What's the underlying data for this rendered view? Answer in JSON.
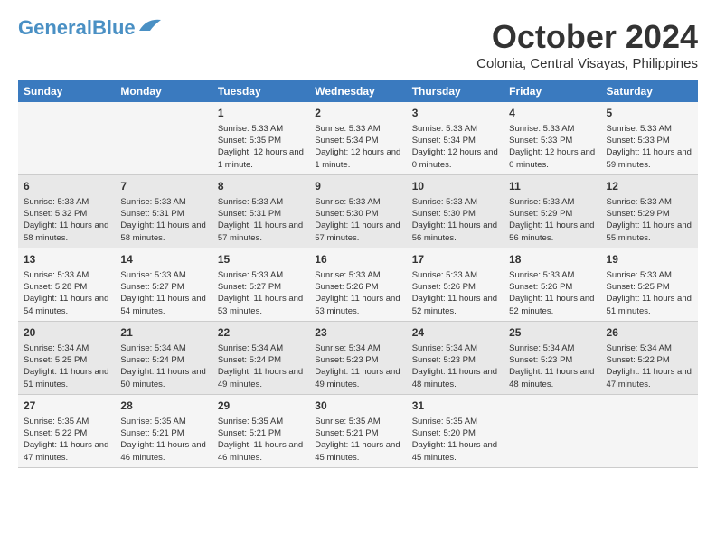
{
  "logo": {
    "part1": "General",
    "part2": "Blue"
  },
  "title": "October 2024",
  "location": "Colonia, Central Visayas, Philippines",
  "weekdays": [
    "Sunday",
    "Monday",
    "Tuesday",
    "Wednesday",
    "Thursday",
    "Friday",
    "Saturday"
  ],
  "weeks": [
    [
      {
        "day": "",
        "info": ""
      },
      {
        "day": "",
        "info": ""
      },
      {
        "day": "1",
        "info": "Sunrise: 5:33 AM\nSunset: 5:35 PM\nDaylight: 12 hours and 1 minute."
      },
      {
        "day": "2",
        "info": "Sunrise: 5:33 AM\nSunset: 5:34 PM\nDaylight: 12 hours and 1 minute."
      },
      {
        "day": "3",
        "info": "Sunrise: 5:33 AM\nSunset: 5:34 PM\nDaylight: 12 hours and 0 minutes."
      },
      {
        "day": "4",
        "info": "Sunrise: 5:33 AM\nSunset: 5:33 PM\nDaylight: 12 hours and 0 minutes."
      },
      {
        "day": "5",
        "info": "Sunrise: 5:33 AM\nSunset: 5:33 PM\nDaylight: 11 hours and 59 minutes."
      }
    ],
    [
      {
        "day": "6",
        "info": "Sunrise: 5:33 AM\nSunset: 5:32 PM\nDaylight: 11 hours and 58 minutes."
      },
      {
        "day": "7",
        "info": "Sunrise: 5:33 AM\nSunset: 5:31 PM\nDaylight: 11 hours and 58 minutes."
      },
      {
        "day": "8",
        "info": "Sunrise: 5:33 AM\nSunset: 5:31 PM\nDaylight: 11 hours and 57 minutes."
      },
      {
        "day": "9",
        "info": "Sunrise: 5:33 AM\nSunset: 5:30 PM\nDaylight: 11 hours and 57 minutes."
      },
      {
        "day": "10",
        "info": "Sunrise: 5:33 AM\nSunset: 5:30 PM\nDaylight: 11 hours and 56 minutes."
      },
      {
        "day": "11",
        "info": "Sunrise: 5:33 AM\nSunset: 5:29 PM\nDaylight: 11 hours and 56 minutes."
      },
      {
        "day": "12",
        "info": "Sunrise: 5:33 AM\nSunset: 5:29 PM\nDaylight: 11 hours and 55 minutes."
      }
    ],
    [
      {
        "day": "13",
        "info": "Sunrise: 5:33 AM\nSunset: 5:28 PM\nDaylight: 11 hours and 54 minutes."
      },
      {
        "day": "14",
        "info": "Sunrise: 5:33 AM\nSunset: 5:27 PM\nDaylight: 11 hours and 54 minutes."
      },
      {
        "day": "15",
        "info": "Sunrise: 5:33 AM\nSunset: 5:27 PM\nDaylight: 11 hours and 53 minutes."
      },
      {
        "day": "16",
        "info": "Sunrise: 5:33 AM\nSunset: 5:26 PM\nDaylight: 11 hours and 53 minutes."
      },
      {
        "day": "17",
        "info": "Sunrise: 5:33 AM\nSunset: 5:26 PM\nDaylight: 11 hours and 52 minutes."
      },
      {
        "day": "18",
        "info": "Sunrise: 5:33 AM\nSunset: 5:26 PM\nDaylight: 11 hours and 52 minutes."
      },
      {
        "day": "19",
        "info": "Sunrise: 5:33 AM\nSunset: 5:25 PM\nDaylight: 11 hours and 51 minutes."
      }
    ],
    [
      {
        "day": "20",
        "info": "Sunrise: 5:34 AM\nSunset: 5:25 PM\nDaylight: 11 hours and 51 minutes."
      },
      {
        "day": "21",
        "info": "Sunrise: 5:34 AM\nSunset: 5:24 PM\nDaylight: 11 hours and 50 minutes."
      },
      {
        "day": "22",
        "info": "Sunrise: 5:34 AM\nSunset: 5:24 PM\nDaylight: 11 hours and 49 minutes."
      },
      {
        "day": "23",
        "info": "Sunrise: 5:34 AM\nSunset: 5:23 PM\nDaylight: 11 hours and 49 minutes."
      },
      {
        "day": "24",
        "info": "Sunrise: 5:34 AM\nSunset: 5:23 PM\nDaylight: 11 hours and 48 minutes."
      },
      {
        "day": "25",
        "info": "Sunrise: 5:34 AM\nSunset: 5:23 PM\nDaylight: 11 hours and 48 minutes."
      },
      {
        "day": "26",
        "info": "Sunrise: 5:34 AM\nSunset: 5:22 PM\nDaylight: 11 hours and 47 minutes."
      }
    ],
    [
      {
        "day": "27",
        "info": "Sunrise: 5:35 AM\nSunset: 5:22 PM\nDaylight: 11 hours and 47 minutes."
      },
      {
        "day": "28",
        "info": "Sunrise: 5:35 AM\nSunset: 5:21 PM\nDaylight: 11 hours and 46 minutes."
      },
      {
        "day": "29",
        "info": "Sunrise: 5:35 AM\nSunset: 5:21 PM\nDaylight: 11 hours and 46 minutes."
      },
      {
        "day": "30",
        "info": "Sunrise: 5:35 AM\nSunset: 5:21 PM\nDaylight: 11 hours and 45 minutes."
      },
      {
        "day": "31",
        "info": "Sunrise: 5:35 AM\nSunset: 5:20 PM\nDaylight: 11 hours and 45 minutes."
      },
      {
        "day": "",
        "info": ""
      },
      {
        "day": "",
        "info": ""
      }
    ]
  ]
}
